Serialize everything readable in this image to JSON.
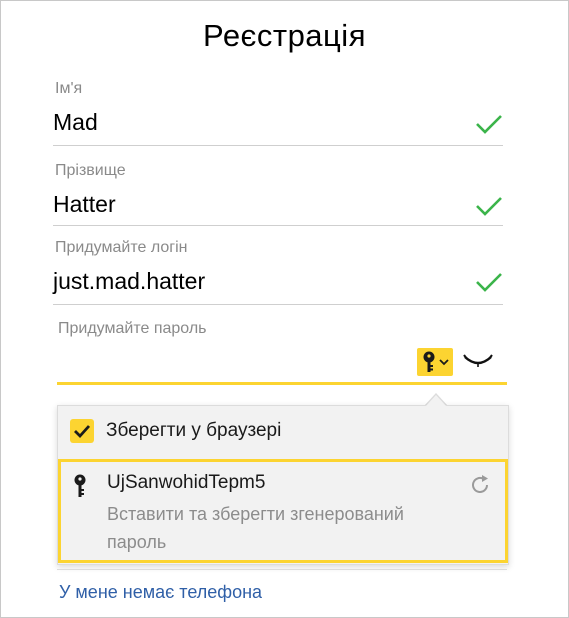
{
  "title": "Реєстрація",
  "fields": [
    {
      "label": "Ім'я",
      "value": "Mad",
      "valid": true
    },
    {
      "label": "Прізвище",
      "value": "Hatter",
      "valid": true
    },
    {
      "label": "Придумайте логін",
      "value": "just.mad.hatter",
      "valid": true
    }
  ],
  "password": {
    "label": "Придумайте пароль",
    "value": ""
  },
  "popup": {
    "save_label": "Зберегти у браузері",
    "save_checked": true,
    "suggested_password": "UjSanwohidTepm5",
    "suggestion_hint": "Вставити та зберегти згенерований пароль"
  },
  "link": {
    "no_phone": "У мене немає телефона"
  },
  "colors": {
    "accent_yellow": "#fcd431",
    "valid_green": "#3bb44a",
    "link_blue": "#2f5fa7",
    "label_gray": "#8a8a8a"
  }
}
